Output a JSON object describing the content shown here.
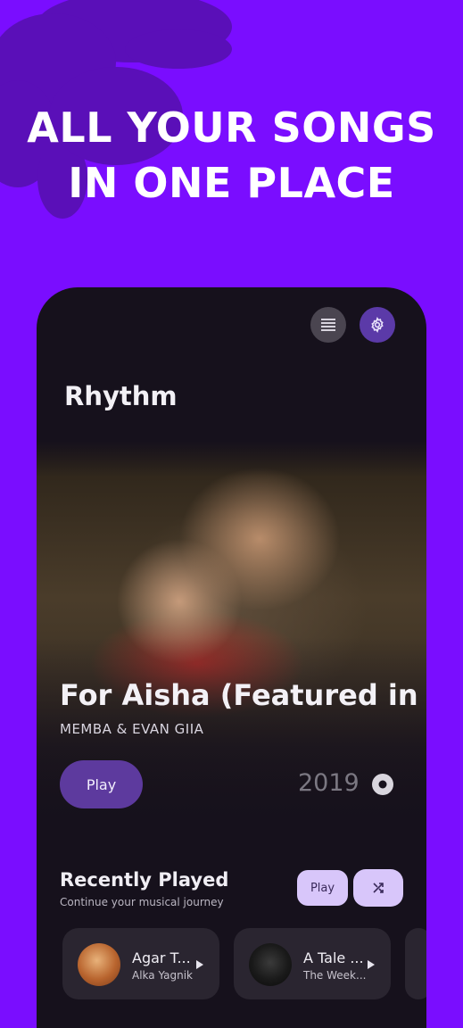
{
  "headline": {
    "line1": "ALL YOUR SONGS",
    "line2": "IN ONE PLACE"
  },
  "colors": {
    "background": "#7a0dff",
    "flower": "#5a0fb8",
    "accent": "#5d3a9e",
    "chip": "#d8c6fa",
    "panel": "#16111c"
  },
  "app": {
    "title": "Rhythm"
  },
  "toolbar": {
    "list_icon": "list-icon",
    "settings_icon": "gear-icon"
  },
  "featured": {
    "title": "For Aisha (Featured in...",
    "artist": "MEMBA & EVAN GIIA",
    "play_label": "Play",
    "year": "2019",
    "disc_icon": "disc-icon"
  },
  "recent": {
    "title": "Recently Played",
    "subtitle": "Continue your musical journey",
    "play_label": "Play",
    "shuffle_icon": "shuffle-icon",
    "items": [
      {
        "title": "Agar T...",
        "artist": "Alka Yagnik"
      },
      {
        "title": "A Tale ...",
        "artist": "The Week..."
      }
    ]
  }
}
